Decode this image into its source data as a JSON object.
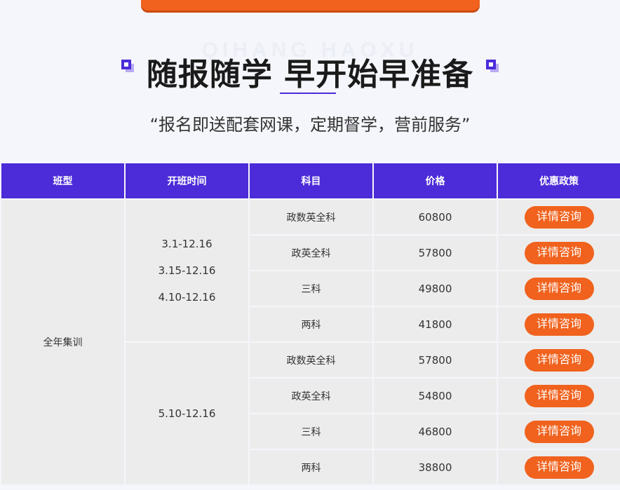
{
  "ghost_text": "QIHANG HAOXU",
  "title": "随报随学 早开始早准备",
  "subtitle": "“报名即送配套网课，定期督学，营前服务”",
  "table": {
    "headers": [
      "班型",
      "开班时间",
      "科目",
      "价格",
      "优惠政策"
    ],
    "class_type": "全年集训",
    "groups": [
      {
        "dates": [
          "3.1-12.16",
          "3.15-12.16",
          "4.10-12.16"
        ],
        "rows": [
          {
            "subject": "政数英全科",
            "price": "60800"
          },
          {
            "subject": "政英全科",
            "price": "57800"
          },
          {
            "subject": "三科",
            "price": "49800"
          },
          {
            "subject": "两科",
            "price": "41800"
          }
        ]
      },
      {
        "dates": [
          "5.10-12.16"
        ],
        "rows": [
          {
            "subject": "政数英全科",
            "price": "57800"
          },
          {
            "subject": "政英全科",
            "price": "54800"
          },
          {
            "subject": "三科",
            "price": "46800"
          },
          {
            "subject": "两科",
            "price": "38800"
          }
        ]
      }
    ],
    "button_label": "详情咨询"
  },
  "colors": {
    "accent": "#4c2bd8",
    "button": "#f0621d"
  }
}
